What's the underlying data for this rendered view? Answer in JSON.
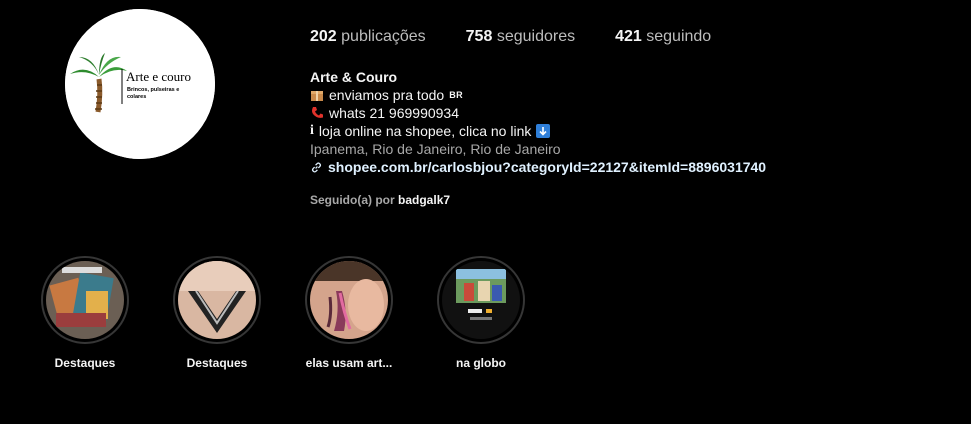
{
  "profile": {
    "avatar": {
      "title": "Arte e couro",
      "subtitle_line1": "Brincos, pulseiras e",
      "subtitle_line2": "colares"
    },
    "stats": [
      {
        "count": "202",
        "label": "publicações"
      },
      {
        "count": "758",
        "label": "seguidores"
      },
      {
        "count": "421",
        "label": "seguindo"
      }
    ],
    "bio": {
      "name": "Arte & Couro",
      "line1_text": "enviamos pra todo",
      "line1_tag": "BR",
      "line2_text": "whats 21 969990934",
      "line3_text": "loja online na shopee, clica no link",
      "location": "Ipanema, Rio de Janeiro, Rio de Janeiro",
      "link": "shopee.com.br/carlosbjou?categoryId=22127&itemId=8896031740"
    },
    "followed_by": {
      "prefix": "Seguido(a) por",
      "user": "badgalk7"
    }
  },
  "highlights": [
    {
      "label": "Destaques"
    },
    {
      "label": "Destaques"
    },
    {
      "label": "elas usam art..."
    },
    {
      "label": "na globo"
    }
  ],
  "colors": {
    "background": "#000000",
    "text": "#f5f5f5",
    "muted": "#a8a8a8",
    "link": "#e0f1ff",
    "ring": "#363636"
  }
}
